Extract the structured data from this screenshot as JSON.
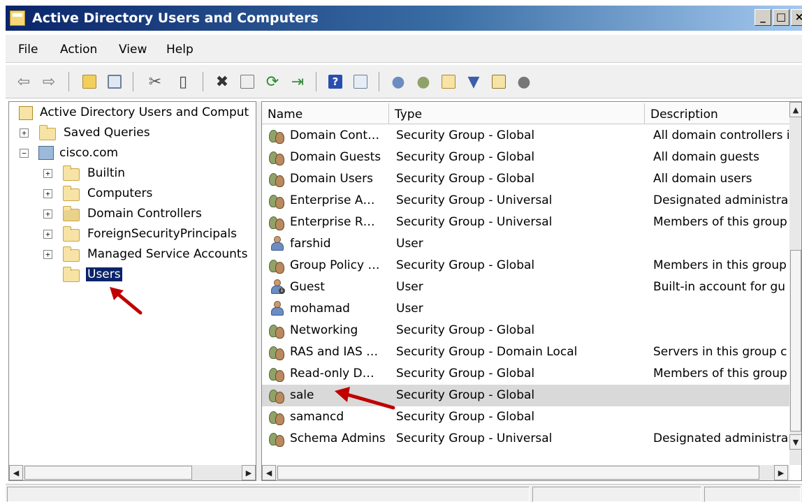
{
  "window": {
    "title": "Active Directory Users and Computers",
    "buttons": [
      "_",
      "□",
      "×"
    ]
  },
  "menu": [
    "File",
    "Action",
    "View",
    "Help"
  ],
  "toolbar": {
    "icons": [
      "back-icon",
      "forward-icon",
      "up-folder-icon",
      "show-hide-console-tree-icon",
      "cut-icon",
      "copy-icon",
      "delete-icon",
      "properties-icon",
      "refresh-icon",
      "export-list-icon",
      "help-icon",
      "view-icon",
      "new-user-icon",
      "new-group-icon",
      "new-ou-icon",
      "filter-icon",
      "find-icon",
      "add-to-group-icon"
    ]
  },
  "tree": {
    "root": "Active Directory Users and Comput",
    "saved_queries": "Saved Queries",
    "domain": "cisco.com",
    "children": [
      "Builtin",
      "Computers",
      "Domain Controllers",
      "ForeignSecurityPrincipals",
      "Managed Service Accounts",
      "Users"
    ]
  },
  "list": {
    "columns": [
      "Name",
      "Type",
      "Description"
    ],
    "rows": [
      {
        "icon": "group",
        "name": "Domain Cont…",
        "type": "Security Group - Global",
        "description": "All domain controllers i"
      },
      {
        "icon": "group",
        "name": "Domain Guests",
        "type": "Security Group - Global",
        "description": "All domain guests"
      },
      {
        "icon": "group",
        "name": "Domain Users",
        "type": "Security Group - Global",
        "description": "All domain users"
      },
      {
        "icon": "group",
        "name": "Enterprise A…",
        "type": "Security Group - Universal",
        "description": "Designated administra"
      },
      {
        "icon": "group",
        "name": "Enterprise R…",
        "type": "Security Group - Universal",
        "description": "Members of this group"
      },
      {
        "icon": "user",
        "name": "farshid",
        "type": "User",
        "description": ""
      },
      {
        "icon": "group",
        "name": "Group Policy …",
        "type": "Security Group - Global",
        "description": "Members in this group"
      },
      {
        "icon": "user-disabled",
        "name": "Guest",
        "type": "User",
        "description": "Built-in account for gu"
      },
      {
        "icon": "user",
        "name": "mohamad",
        "type": "User",
        "description": ""
      },
      {
        "icon": "group",
        "name": "Networking",
        "type": "Security Group - Global",
        "description": ""
      },
      {
        "icon": "group",
        "name": "RAS and IAS …",
        "type": "Security Group - Domain Local",
        "description": "Servers in this group c"
      },
      {
        "icon": "group",
        "name": "Read-only D…",
        "type": "Security Group - Global",
        "description": "Members of this group"
      },
      {
        "icon": "group",
        "name": "sale",
        "type": "Security Group - Global",
        "description": ""
      },
      {
        "icon": "group",
        "name": "samancd",
        "type": "Security Group - Global",
        "description": ""
      },
      {
        "icon": "group",
        "name": "Schema Admins",
        "type": "Security Group - Universal",
        "description": "Designated administra"
      }
    ],
    "highlighted_row": "sale"
  },
  "colors": {
    "selection": "#0a246a",
    "highlight_row": "#d9d9d9",
    "annotation_arrow": "#c00000"
  }
}
